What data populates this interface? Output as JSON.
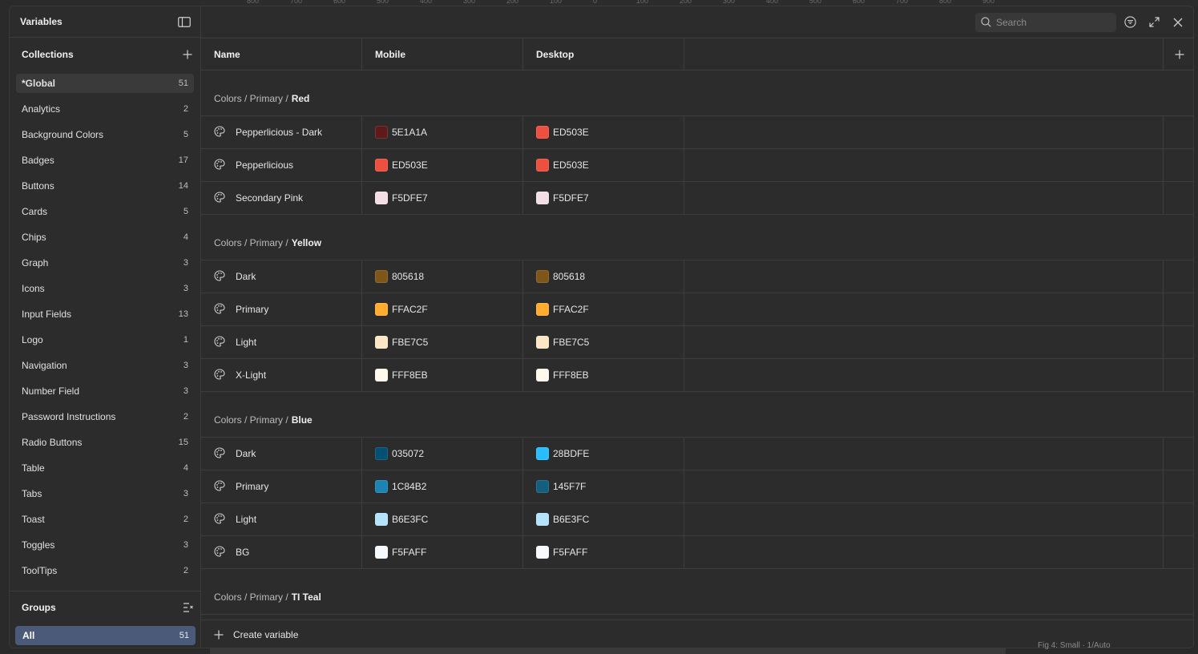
{
  "ruler": [
    "800",
    "700",
    "600",
    "500",
    "400",
    "300",
    "200",
    "100",
    "0",
    "100",
    "200",
    "300",
    "400",
    "500",
    "600",
    "700",
    "800",
    "900"
  ],
  "background_label": "Fig 4: Small · 1/Auto",
  "sidebar": {
    "title": "Variables",
    "collections_title": "Collections",
    "collections": [
      {
        "name": "*Global",
        "count": "51"
      },
      {
        "name": "Analytics",
        "count": "2"
      },
      {
        "name": "Background Colors",
        "count": "5"
      },
      {
        "name": "Badges",
        "count": "17"
      },
      {
        "name": "Buttons",
        "count": "14"
      },
      {
        "name": "Cards",
        "count": "5"
      },
      {
        "name": "Chips",
        "count": "4"
      },
      {
        "name": "Graph",
        "count": "3"
      },
      {
        "name": "Icons",
        "count": "3"
      },
      {
        "name": "Input Fields",
        "count": "13"
      },
      {
        "name": "Logo",
        "count": "1"
      },
      {
        "name": "Navigation",
        "count": "3"
      },
      {
        "name": "Number Field",
        "count": "3"
      },
      {
        "name": "Password Instructions",
        "count": "2"
      },
      {
        "name": "Radio Buttons",
        "count": "15"
      },
      {
        "name": "Table",
        "count": "4"
      },
      {
        "name": "Tabs",
        "count": "3"
      },
      {
        "name": "Toast",
        "count": "2"
      },
      {
        "name": "Toggles",
        "count": "3"
      },
      {
        "name": "ToolTips",
        "count": "2"
      }
    ],
    "groups_title": "Groups",
    "groups_all": {
      "name": "All",
      "count": "51"
    }
  },
  "search": {
    "placeholder": "Search"
  },
  "table": {
    "headers": {
      "name": "Name",
      "mobile": "Mobile",
      "desktop": "Desktop"
    },
    "groups": [
      {
        "path": "Colors / Primary /",
        "leaf": "Red",
        "rows": [
          {
            "name": "Pepperlicious - Dark",
            "mobile": "5E1A1A",
            "mobile_color": "#5E1A1A",
            "desktop": "ED503E",
            "desktop_color": "#ED503E"
          },
          {
            "name": "Pepperlicious",
            "mobile": "ED503E",
            "mobile_color": "#ED503E",
            "desktop": "ED503E",
            "desktop_color": "#ED503E"
          },
          {
            "name": "Secondary Pink",
            "mobile": "F5DFE7",
            "mobile_color": "#F5DFE7",
            "desktop": "F5DFE7",
            "desktop_color": "#F5DFE7"
          }
        ]
      },
      {
        "path": "Colors / Primary /",
        "leaf": "Yellow",
        "rows": [
          {
            "name": "Dark",
            "mobile": "805618",
            "mobile_color": "#805618",
            "desktop": "805618",
            "desktop_color": "#805618"
          },
          {
            "name": "Primary",
            "mobile": "FFAC2F",
            "mobile_color": "#FFAC2F",
            "desktop": "FFAC2F",
            "desktop_color": "#FFAC2F"
          },
          {
            "name": "Light",
            "mobile": "FBE7C5",
            "mobile_color": "#FBE7C5",
            "desktop": "FBE7C5",
            "desktop_color": "#FBE7C5"
          },
          {
            "name": "X-Light",
            "mobile": "FFF8EB",
            "mobile_color": "#FFF8EB",
            "desktop": "FFF8EB",
            "desktop_color": "#FFF8EB"
          }
        ]
      },
      {
        "path": "Colors / Primary /",
        "leaf": "Blue",
        "rows": [
          {
            "name": "Dark",
            "mobile": "035072",
            "mobile_color": "#035072",
            "desktop": "28BDFE",
            "desktop_color": "#28BDFE"
          },
          {
            "name": "Primary",
            "mobile": "1C84B2",
            "mobile_color": "#1C84B2",
            "desktop": "145F7F",
            "desktop_color": "#145F7F"
          },
          {
            "name": "Light",
            "mobile": "B6E3FC",
            "mobile_color": "#B6E3FC",
            "desktop": "B6E3FC",
            "desktop_color": "#B6E3FC"
          },
          {
            "name": "BG",
            "mobile": "F5FAFF",
            "mobile_color": "#F5FAFF",
            "desktop": "F5FAFF",
            "desktop_color": "#F5FAFF"
          }
        ]
      },
      {
        "path": "Colors / Primary /",
        "leaf": "TI Teal",
        "rows": []
      }
    ]
  },
  "create_variable": "Create variable"
}
